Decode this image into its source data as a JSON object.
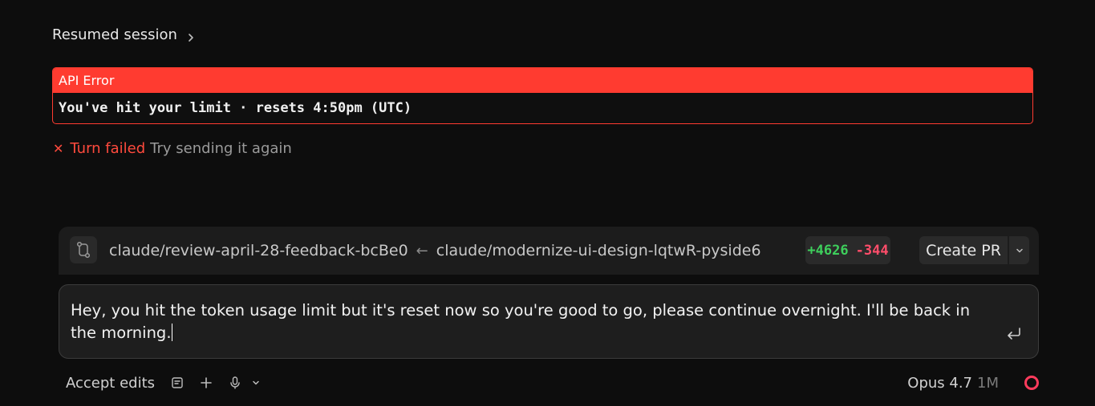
{
  "session": {
    "title": "Resumed session"
  },
  "error": {
    "title": "API Error",
    "message": "You've hit your limit · resets 4:50pm (UTC)"
  },
  "turn": {
    "status": "Turn failed",
    "retry": "Try sending it again"
  },
  "branch": {
    "target": "claude/review-april-28-feedback-bcBe0",
    "arrow": "←",
    "source": "claude/modernize-ui-design-lqtwR-pyside6",
    "additions": "+4626",
    "deletions": "-344",
    "pr_label": "Create PR"
  },
  "composer": {
    "text": "Hey, you hit the token usage limit but it's reset now so you're good to go, please continue overnight. I'll be back in the morning."
  },
  "toolbar": {
    "mode": "Accept edits",
    "model": "Opus 4.7",
    "context": "1M"
  },
  "colors": {
    "error_red": "#ff3b30",
    "add_green": "#3ecf5c",
    "del_red": "#ff4d6a",
    "status_ring": "#ff3b5c"
  }
}
